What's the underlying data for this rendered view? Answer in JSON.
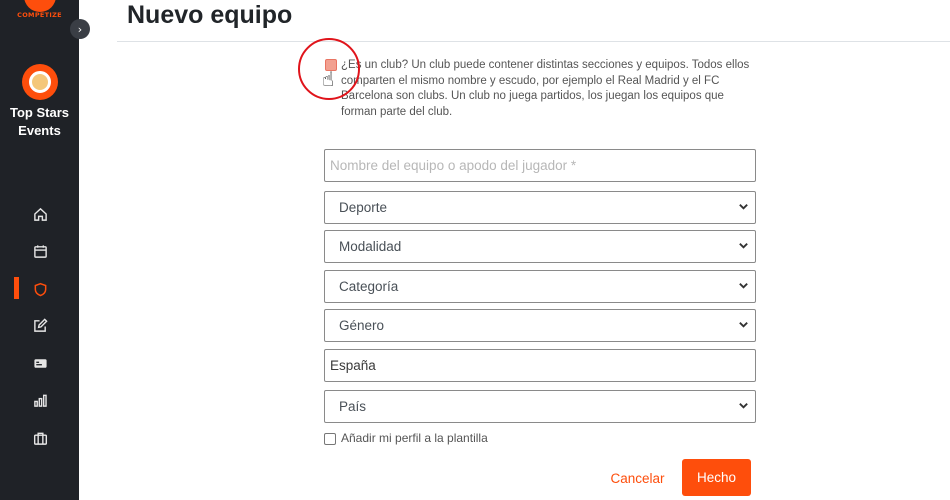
{
  "brand": {
    "name": "COMPETIZE",
    "accent": "#fe4e0c"
  },
  "sidebar": {
    "event_name": "Top Stars Events",
    "collapse_icon": "chevron-right-icon",
    "nav": [
      {
        "icon": "home-icon"
      },
      {
        "icon": "calendar-icon"
      },
      {
        "icon": "shield-icon",
        "active": true
      },
      {
        "icon": "edit-icon"
      },
      {
        "icon": "id-card-icon"
      },
      {
        "icon": "bar-chart-icon"
      },
      {
        "icon": "briefcase-icon"
      }
    ]
  },
  "page": {
    "title": "Nuevo equipo"
  },
  "club_option": {
    "checked": false,
    "text": "¿Es un club? Un club puede contener distintas secciones y equipos. Todos ellos comparten el mismo nombre y escudo, por ejemplo el Real Madrid y el FC Barcelona son clubs. Un club no juega partidos, los juegan los equipos que forman parte del club."
  },
  "form": {
    "name_placeholder": "Nombre del equipo o apodo del jugador *",
    "sport": "Deporte",
    "modality": "Modalidad",
    "category": "Categoría",
    "gender": "Género",
    "region": "España",
    "country": "País",
    "add_profile_label": "Añadir mi perfil a la plantilla"
  },
  "actions": {
    "cancel": "Cancelar",
    "done": "Hecho"
  }
}
